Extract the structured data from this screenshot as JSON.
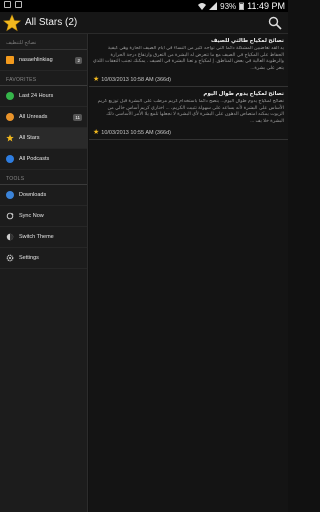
{
  "status_bar": {
    "left_icons": [
      "notification-icon",
      "image-icon"
    ],
    "battery": "93%",
    "time": "11:49 PM"
  },
  "action_bar": {
    "title": "All Stars (2)",
    "search_icon": "search-icon"
  },
  "drawer": {
    "feed_section_label": "نصائح للتنظيف",
    "feeds": [
      {
        "label": "nasaehlinkiag",
        "count": "2",
        "icon": "rss-icon"
      }
    ],
    "favorites_heading": "FAVORITES",
    "favorites": [
      {
        "label": "Last 24 Hours",
        "count": "",
        "icon": "clock-icon"
      },
      {
        "label": "All Unreads",
        "count": "11",
        "icon": "unread-icon"
      },
      {
        "label": "All Stars",
        "count": "",
        "icon": "star-icon"
      },
      {
        "label": "All Podcasts",
        "count": "",
        "icon": "podcast-icon"
      }
    ],
    "tools_heading": "TOOLS",
    "tools": [
      {
        "label": "Downloads",
        "icon": "download-icon"
      },
      {
        "label": "Sync Now",
        "icon": "sync-icon"
      },
      {
        "label": "Switch Theme",
        "icon": "theme-icon"
      },
      {
        "label": "Settings",
        "icon": "gear-icon"
      }
    ]
  },
  "articles": [
    {
      "title": "نصائح لمكياج طالتي للصيف",
      "excerpt": "يد ألقد تغاضبين المشكلة دائما التي تواجه كثير من النساء في أيام الصيف الحارة وهي كيفية الحفاظ على المكياج في الصيف مع ما تتعرض له البشرة من التعرق وارتفاع درجة الحرارة والرطوبة العالية في بعض المناطق. إ لمكياج و تعنا البشرة في الصيف . يمكنك تجنب التعقات اللذي يتعر على بشرة...",
      "date": "10/03/2013 10:58 AM (366d)",
      "starred": true
    },
    {
      "title": "نصائح لمكياج يدوم طوال اليوم",
      "excerpt": "نصائح لمكياج يدوم طوال اليوم... ينصح دائماً باستخدام كريم مرطب على البشرة قبل توزيع كريم الأساس على البشرة لأنه يساعد على سهولة تثبيت الكريم، ... اختاري كريم أساس خالي من الزيوت يمكنه امتصاص الدهون على البشرة لأي البشرة لا نجعلها تلمع يلا الأمر الأساسي ذلك البشرة خلا يف ...",
      "date": "10/03/2013 10:55 AM (366d)",
      "starred": true
    }
  ],
  "colors": {
    "accent": "#f1b81e",
    "rss": "#f39a1d",
    "green": "#35b54a",
    "blue": "#2e7de0"
  }
}
